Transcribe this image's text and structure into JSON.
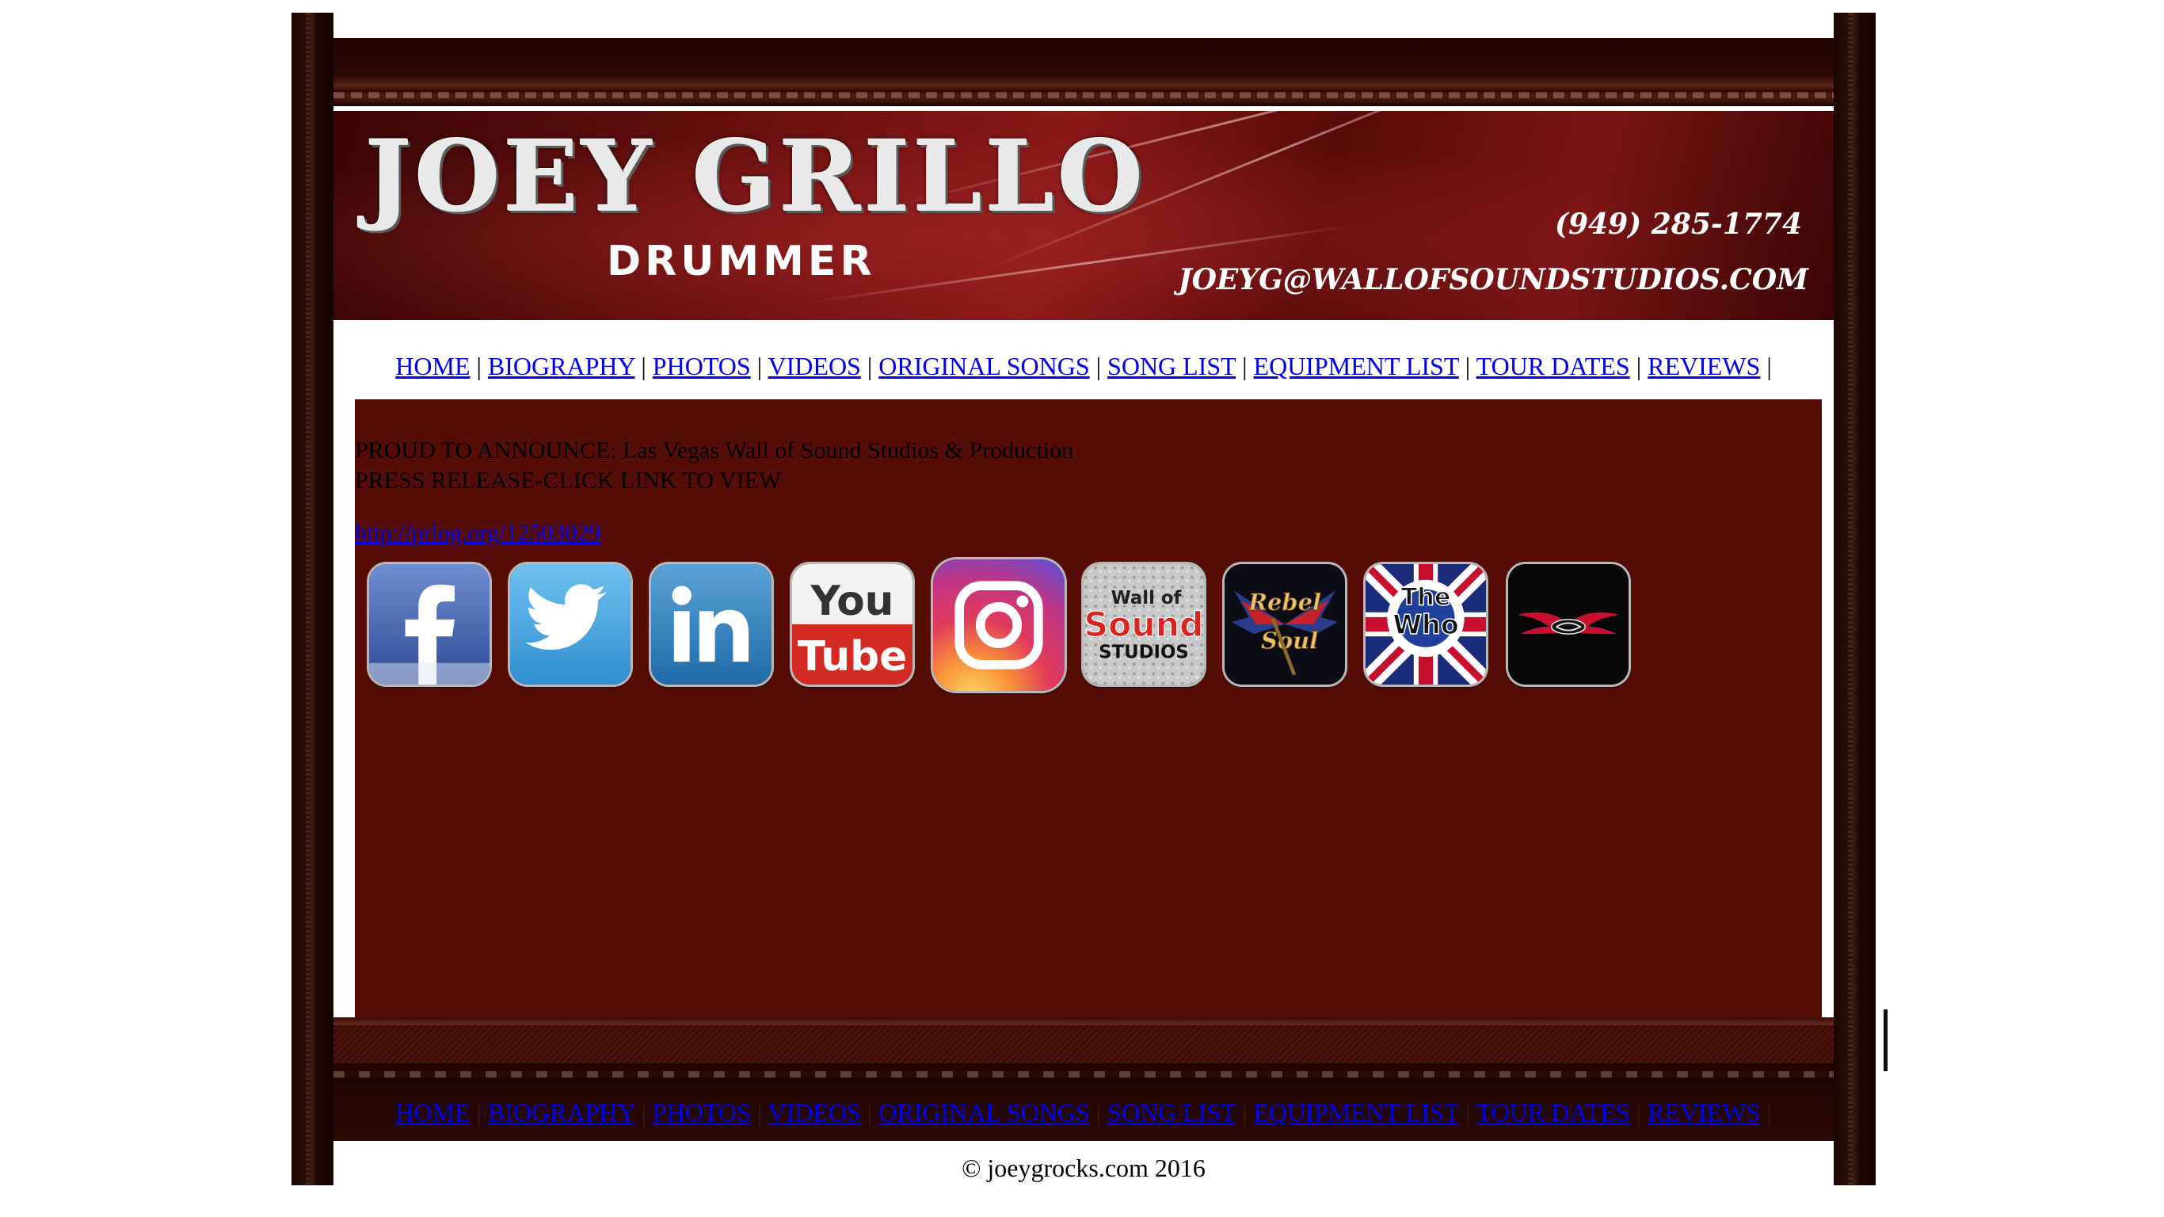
{
  "banner": {
    "name": "JOEY GRILLO",
    "role": "DRUMMER",
    "phone": "(949) 285-1774",
    "email": "JOEYG@WALLOFSOUNDSTUDIOS.COM"
  },
  "nav": {
    "separator": "|",
    "items": [
      {
        "label": "HOME"
      },
      {
        "label": "BIOGRAPHY"
      },
      {
        "label": "PHOTOS"
      },
      {
        "label": "VIDEOS"
      },
      {
        "label": "ORIGINAL SONGS"
      },
      {
        "label": "SONG LIST"
      },
      {
        "label": "EQUIPMENT LIST"
      },
      {
        "label": "TOUR DATES"
      },
      {
        "label": "REVIEWS"
      }
    ]
  },
  "content": {
    "announce_line1": "PROUD TO ANNOUNCE: Las Vegas Wall of Sound Studios & Production",
    "announce_line2": "PRESS RELEASE-CLICK LINK TO VIEW",
    "press_link": "http://prlog.org/12503029"
  },
  "social_icons": [
    {
      "name": "facebook-icon",
      "glyph": "f"
    },
    {
      "name": "twitter-icon",
      "glyph": "bird"
    },
    {
      "name": "linkedin-icon",
      "glyph": "in"
    },
    {
      "name": "youtube-icon",
      "top": "You",
      "bottom": "Tube"
    },
    {
      "name": "instagram-icon",
      "glyph": "camera"
    },
    {
      "name": "wall-of-sound-studios-icon",
      "line1": "Wall of",
      "line2": "Sound",
      "line3": "STUDIOS"
    },
    {
      "name": "rebel-soul-icon",
      "line1": "Rebel",
      "line2": "Soul"
    },
    {
      "name": "the-who-icon",
      "line1": "The",
      "line2": "Who"
    },
    {
      "name": "aerosmith-icon",
      "glyph": "wings"
    }
  ],
  "footer": {
    "copyright": "© joeygrocks.com 2016"
  },
  "colors": {
    "content_bg": "#560d08",
    "frame_dark": "#1f0603",
    "link": "#0000ee"
  }
}
